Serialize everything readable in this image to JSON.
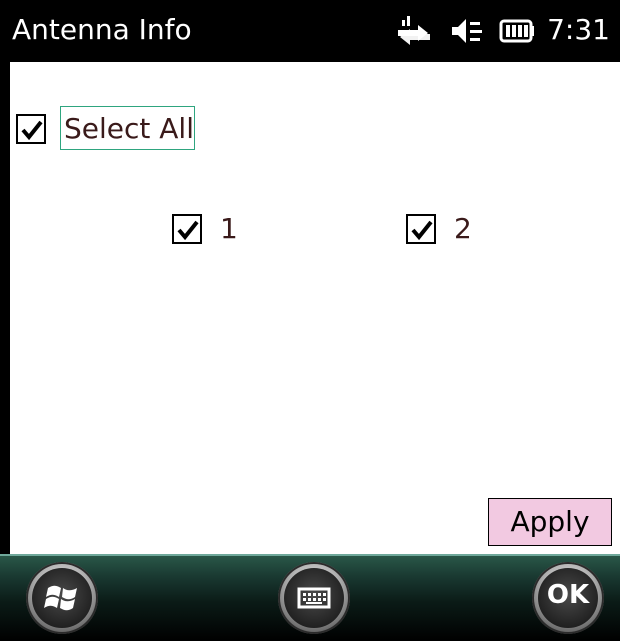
{
  "titlebar": {
    "title": "Antenna Info",
    "time": "7:31",
    "icons": [
      "connectivity-arrows-icon",
      "speaker-volume-icon",
      "battery-icon"
    ]
  },
  "content": {
    "select_all": {
      "label": "Select All",
      "checked": true
    },
    "antennas": [
      {
        "label": "1",
        "checked": true
      },
      {
        "label": "2",
        "checked": true
      }
    ],
    "apply_label": "Apply"
  },
  "bottombar": {
    "ok_label": "OK",
    "start_icon": "windows-start-icon",
    "keyboard_icon": "keyboard-icon"
  },
  "colors": {
    "title_bg": "#000000",
    "apply_bg": "#f2c9e1",
    "focus_border": "#2ea57f",
    "label_text": "#3a1a1a"
  }
}
